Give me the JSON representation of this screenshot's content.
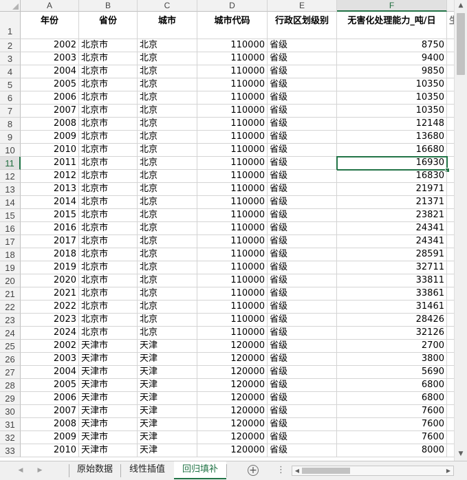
{
  "column_letters": [
    "A",
    "B",
    "C",
    "D",
    "E",
    "F"
  ],
  "headers": [
    "年份",
    "省份",
    "城市",
    "城市代码",
    "行政区划级别",
    "无害化处理能力_吨/日"
  ],
  "overflow_header_char": "生",
  "selected_cell": "F11",
  "rows": [
    [
      "2",
      "2002",
      "北京市",
      "北京",
      "110000",
      "省级",
      "8750"
    ],
    [
      "3",
      "2003",
      "北京市",
      "北京",
      "110000",
      "省级",
      "9400"
    ],
    [
      "4",
      "2004",
      "北京市",
      "北京",
      "110000",
      "省级",
      "9850"
    ],
    [
      "5",
      "2005",
      "北京市",
      "北京",
      "110000",
      "省级",
      "10350"
    ],
    [
      "6",
      "2006",
      "北京市",
      "北京",
      "110000",
      "省级",
      "10350"
    ],
    [
      "7",
      "2007",
      "北京市",
      "北京",
      "110000",
      "省级",
      "10350"
    ],
    [
      "8",
      "2008",
      "北京市",
      "北京",
      "110000",
      "省级",
      "12148"
    ],
    [
      "9",
      "2009",
      "北京市",
      "北京",
      "110000",
      "省级",
      "13680"
    ],
    [
      "10",
      "2010",
      "北京市",
      "北京",
      "110000",
      "省级",
      "16680"
    ],
    [
      "11",
      "2011",
      "北京市",
      "北京",
      "110000",
      "省级",
      "16930"
    ],
    [
      "12",
      "2012",
      "北京市",
      "北京",
      "110000",
      "省级",
      "16830"
    ],
    [
      "13",
      "2013",
      "北京市",
      "北京",
      "110000",
      "省级",
      "21971"
    ],
    [
      "14",
      "2014",
      "北京市",
      "北京",
      "110000",
      "省级",
      "21371"
    ],
    [
      "15",
      "2015",
      "北京市",
      "北京",
      "110000",
      "省级",
      "23821"
    ],
    [
      "16",
      "2016",
      "北京市",
      "北京",
      "110000",
      "省级",
      "24341"
    ],
    [
      "17",
      "2017",
      "北京市",
      "北京",
      "110000",
      "省级",
      "24341"
    ],
    [
      "18",
      "2018",
      "北京市",
      "北京",
      "110000",
      "省级",
      "28591"
    ],
    [
      "19",
      "2019",
      "北京市",
      "北京",
      "110000",
      "省级",
      "32711"
    ],
    [
      "20",
      "2020",
      "北京市",
      "北京",
      "110000",
      "省级",
      "33811"
    ],
    [
      "21",
      "2021",
      "北京市",
      "北京",
      "110000",
      "省级",
      "33861"
    ],
    [
      "22",
      "2022",
      "北京市",
      "北京",
      "110000",
      "省级",
      "31461"
    ],
    [
      "23",
      "2023",
      "北京市",
      "北京",
      "110000",
      "省级",
      "28426"
    ],
    [
      "24",
      "2024",
      "北京市",
      "北京",
      "110000",
      "省级",
      "32126"
    ],
    [
      "25",
      "2002",
      "天津市",
      "天津",
      "120000",
      "省级",
      "2700"
    ],
    [
      "26",
      "2003",
      "天津市",
      "天津",
      "120000",
      "省级",
      "3800"
    ],
    [
      "27",
      "2004",
      "天津市",
      "天津",
      "120000",
      "省级",
      "5690"
    ],
    [
      "28",
      "2005",
      "天津市",
      "天津",
      "120000",
      "省级",
      "6800"
    ],
    [
      "29",
      "2006",
      "天津市",
      "天津",
      "120000",
      "省级",
      "6800"
    ],
    [
      "30",
      "2007",
      "天津市",
      "天津",
      "120000",
      "省级",
      "7600"
    ],
    [
      "31",
      "2008",
      "天津市",
      "天津",
      "120000",
      "省级",
      "7600"
    ],
    [
      "32",
      "2009",
      "天津市",
      "天津",
      "120000",
      "省级",
      "7600"
    ],
    [
      "33",
      "2010",
      "天津市",
      "天津",
      "120000",
      "省级",
      "8000"
    ]
  ],
  "sheet_tabs": [
    {
      "label": "原始数据",
      "active": false
    },
    {
      "label": "线性插值",
      "active": false
    },
    {
      "label": "回归填补",
      "active": true
    }
  ],
  "icons": {
    "add_sheet": "plus-circle-icon",
    "tab_prev": "triangle-left-icon",
    "tab_next": "triangle-right-icon",
    "more": "vertical-ellipsis-icon"
  },
  "colors": {
    "accent": "#217346",
    "grid": "#d4d4d4",
    "header_bg": "#f2f2f2"
  }
}
